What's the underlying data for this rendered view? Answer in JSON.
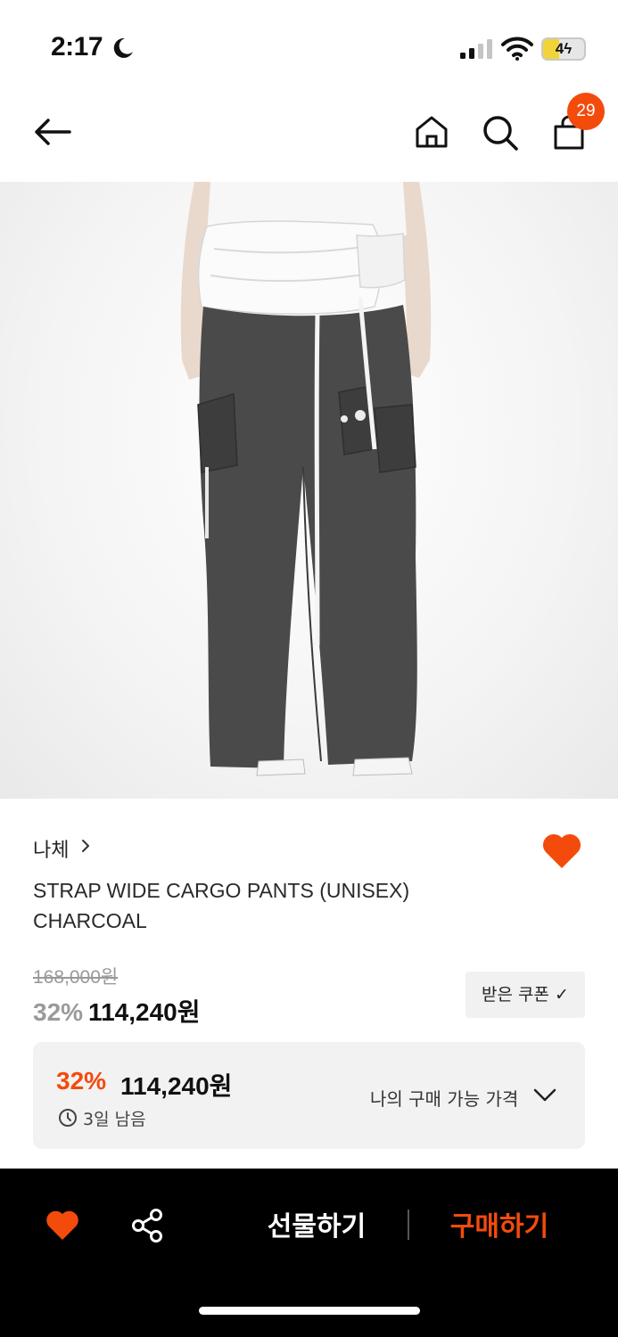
{
  "status_bar": {
    "time": "2:17",
    "battery": "4",
    "battery_level": 0.4
  },
  "header": {
    "cart_count": "29",
    "icons": [
      "back-arrow-icon",
      "home-icon",
      "search-icon",
      "shopping-bag-icon"
    ]
  },
  "product": {
    "brand": "나체",
    "title": "STRAP WIDE CARGO PANTS (UNISEX) CHARCOAL",
    "original_price": "168,000원",
    "discount_rate": "32%",
    "sale_price": "114,240원",
    "coupon_label": "받은 쿠폰 ✓"
  },
  "my_price": {
    "discount_rate": "32%",
    "price": "114,240원",
    "remaining": "3일 남음",
    "label": "나의 구매 가능 가격"
  },
  "bottom_bar": {
    "gift_label": "선물하기",
    "buy_label": "구매하기"
  },
  "colors": {
    "accent": "#f34b0c",
    "bottom_bar": "#000000",
    "card_bg": "#f2f2f2"
  }
}
